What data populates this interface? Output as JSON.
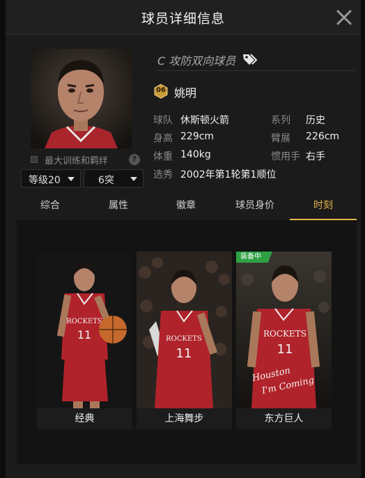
{
  "header": {
    "title": "球员详细信息"
  },
  "player": {
    "role": "C 攻防双向球员",
    "badge_number": "06",
    "name": "姚明"
  },
  "training": {
    "label": "最大训练和羁绊",
    "help": "?"
  },
  "selectors": {
    "level": "等级20",
    "breakthrough": "6突"
  },
  "info": {
    "team_key": "球队",
    "team_val": "休斯顿火箭",
    "series_key": "系列",
    "series_val": "历史",
    "height_key": "身高",
    "height_val": "229cm",
    "wingspan_key": "臂展",
    "wingspan_val": "226cm",
    "weight_key": "体重",
    "weight_val": "140kg",
    "hand_key": "惯用手",
    "hand_val": "右手",
    "draft_key": "选秀",
    "draft_val": "2002年第1轮第1顺位"
  },
  "tabs": [
    "综合",
    "属性",
    "徽章",
    "球员身价",
    "时刻"
  ],
  "active_tab": "时刻",
  "cards": [
    {
      "label": "经典"
    },
    {
      "label": "上海舞步"
    },
    {
      "label": "东方巨人",
      "tag": "装备中",
      "script_text_1": "Houston",
      "script_text_2": "I'm Coming"
    }
  ],
  "jersey": {
    "team": "ROCKETS",
    "number": "11"
  },
  "colors": {
    "accent": "#e8b84a",
    "equip_green": "#2ea043",
    "jersey_red": "#b0232a"
  }
}
